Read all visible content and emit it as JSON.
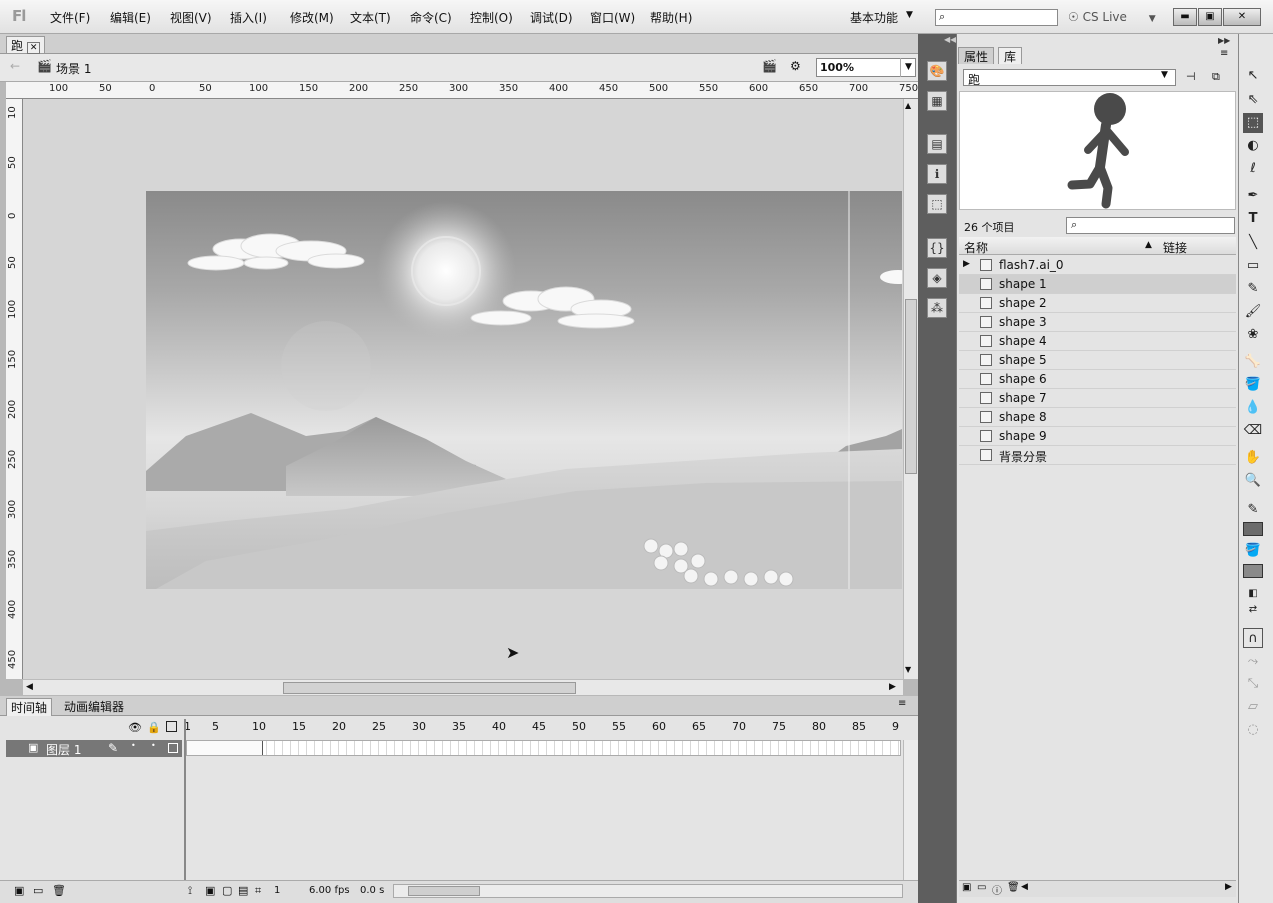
{
  "app": {
    "logo": "Fl"
  },
  "menu": {
    "items": [
      "文件(F)",
      "编辑(E)",
      "视图(V)",
      "插入(I)",
      "修改(M)",
      "文本(T)",
      "命令(C)",
      "控制(O)",
      "调试(D)",
      "窗口(W)",
      "帮助(H)"
    ],
    "workspace": "基本功能",
    "cs_live": "CS Live",
    "search_icon": "⌕"
  },
  "document": {
    "tab_label": "跑",
    "close": "✕",
    "scene": "场景 1",
    "zoom": "100%"
  },
  "ruler": {
    "top": [
      "100",
      "50",
      "0",
      "50",
      "100",
      "150",
      "200",
      "250",
      "300",
      "350",
      "400",
      "450",
      "500",
      "550",
      "600",
      "650",
      "700",
      "750"
    ],
    "left": [
      "10",
      "50",
      "0",
      "50",
      "100",
      "150",
      "200",
      "250",
      "300",
      "350",
      "400",
      "450"
    ]
  },
  "timeline": {
    "tabs": [
      "时间轴",
      "动画编辑器"
    ],
    "layer_name": "图层 1",
    "frame_numbers": [
      "1",
      "5",
      "10",
      "15",
      "20",
      "25",
      "30",
      "35",
      "40",
      "45",
      "50",
      "55",
      "60",
      "65",
      "70",
      "75",
      "80",
      "85",
      "9"
    ],
    "current_frame": "1",
    "fps": "6.00 fps",
    "time": "0.0 s"
  },
  "right_panel": {
    "tabs": [
      "属性",
      "库"
    ],
    "library_select": "跑",
    "item_count": "26 个项目",
    "col_name": "名称",
    "col_link": "链接",
    "items": [
      "flash7.ai_0",
      "shape 1",
      "shape 2",
      "shape 3",
      "shape 4",
      "shape 5",
      "shape 6",
      "shape 7",
      "shape 8",
      "shape 9",
      "背景分景"
    ]
  },
  "colors": {
    "stroke_swatch": "#6b6b6b",
    "fill_swatch": "#8a8a8a",
    "figure": "#4a4a4a"
  }
}
